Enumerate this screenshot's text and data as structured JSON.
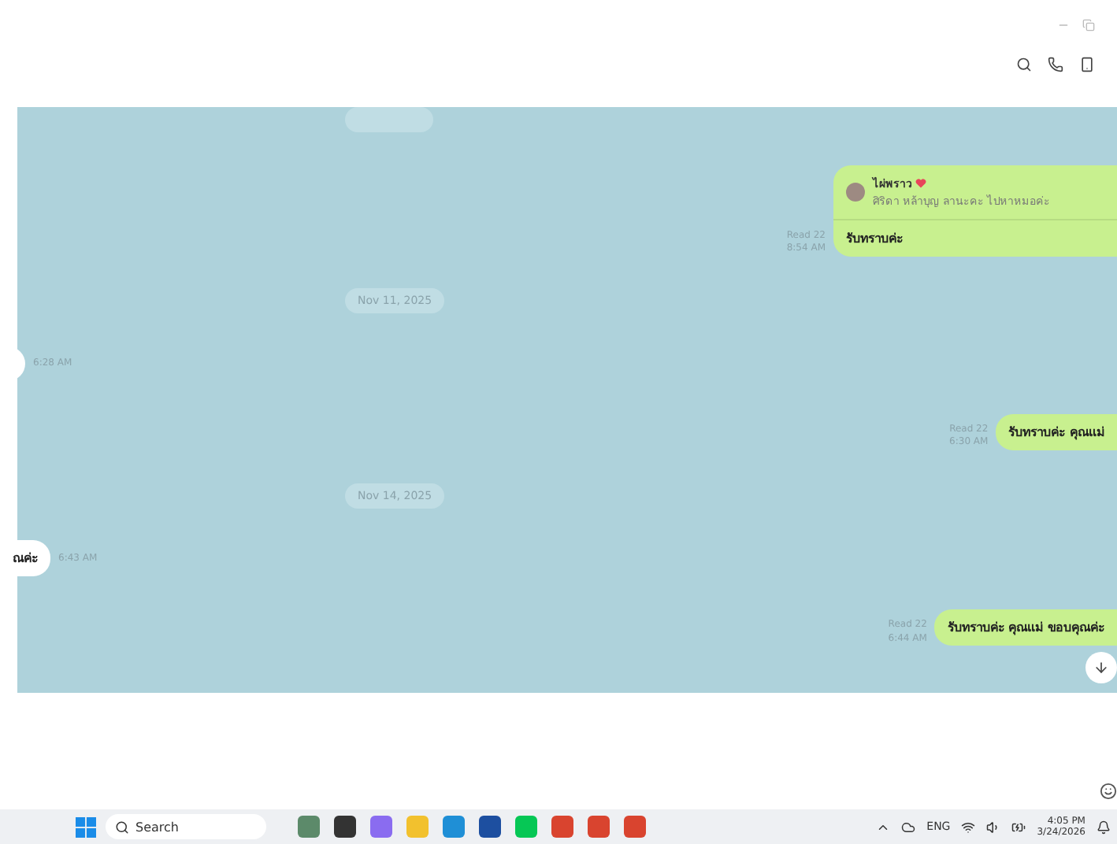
{
  "chat": {
    "messages": [
      {
        "kind": "date"
      },
      {
        "kind": "outgoing",
        "read": "Read 22",
        "time": "8:54 AM",
        "text": "รับทราบค่ะ",
        "reply": {
          "name": "ไผ่พราว",
          "quote": "ศิริดา หล้าบุญ ลานะคะ ไปหาหมอค่ะ"
        }
      },
      {
        "kind": "date",
        "text": "Nov 11, 2025"
      },
      {
        "kind": "incoming",
        "time": "6:28 AM"
      },
      {
        "kind": "outgoing",
        "read": "Read 22",
        "time": "6:30 AM",
        "text": "รับทราบค่ะ คุณแม่"
      },
      {
        "kind": "date",
        "text": "Nov 14, 2025"
      },
      {
        "kind": "incoming",
        "time": "6:43 AM",
        "text": "ณค่ะ"
      },
      {
        "kind": "outgoing",
        "read": "Read 22",
        "time": "6:44 AM",
        "text": "รับทราบค่ะ คุณแม่  ขอบคุณค่ะ"
      }
    ]
  },
  "taskbar": {
    "search": "Search",
    "language": "ENG",
    "time": "4:05 PM",
    "date": "3/24/2026"
  }
}
